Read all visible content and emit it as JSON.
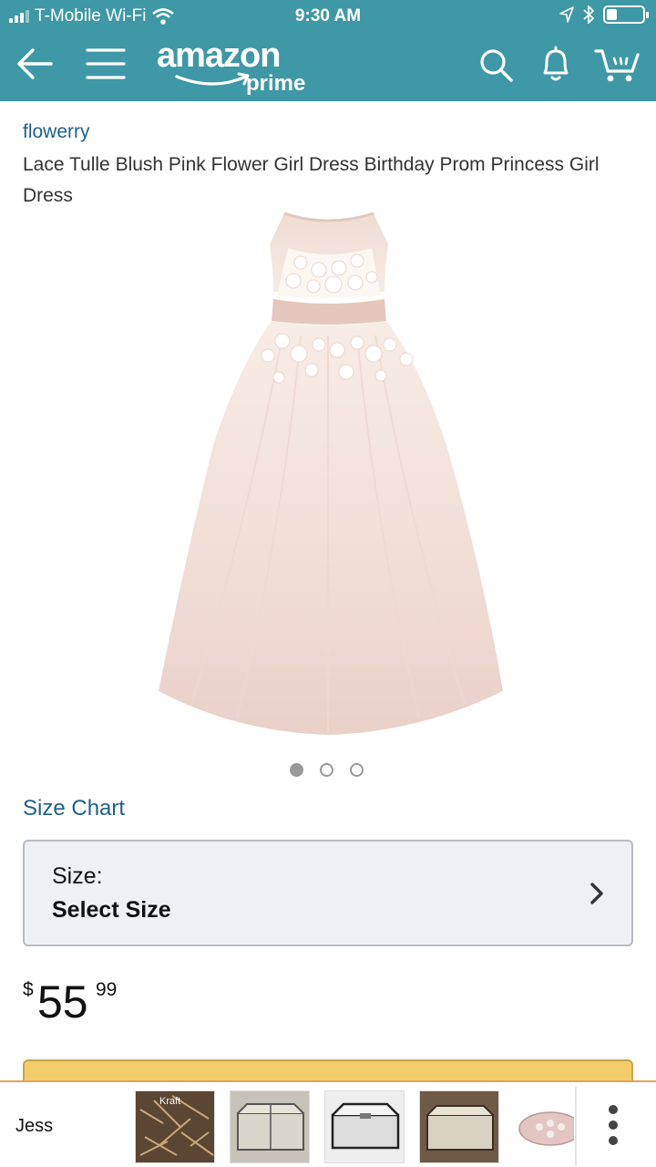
{
  "status_bar": {
    "carrier": "T-Mobile Wi-Fi",
    "time": "9:30 AM",
    "battery_level": 0.3
  },
  "header": {
    "logo_word": "amazon",
    "logo_sub": "prime",
    "background": "#3e98a6",
    "icons": [
      "back-arrow-icon",
      "menu-icon",
      "search-icon",
      "bell-icon",
      "cart-icon"
    ]
  },
  "product": {
    "brand": "flowerry",
    "title": "Lace Tulle Blush Pink Flower Girl Dress Birthday Prom Princess Girl Dress",
    "image_pages": 3,
    "image_page_active": 1,
    "size_chart_label": "Size Chart",
    "size_label": "Size:",
    "size_value": "Select Size",
    "price_currency": "$",
    "price_whole": "55",
    "price_fraction": "99",
    "link_color": "#1f5f8b",
    "buy_color": "#f2cd6a"
  },
  "tray": {
    "name": "Jess",
    "thumbs": [
      "Kraft",
      "",
      "",
      "",
      ""
    ]
  }
}
